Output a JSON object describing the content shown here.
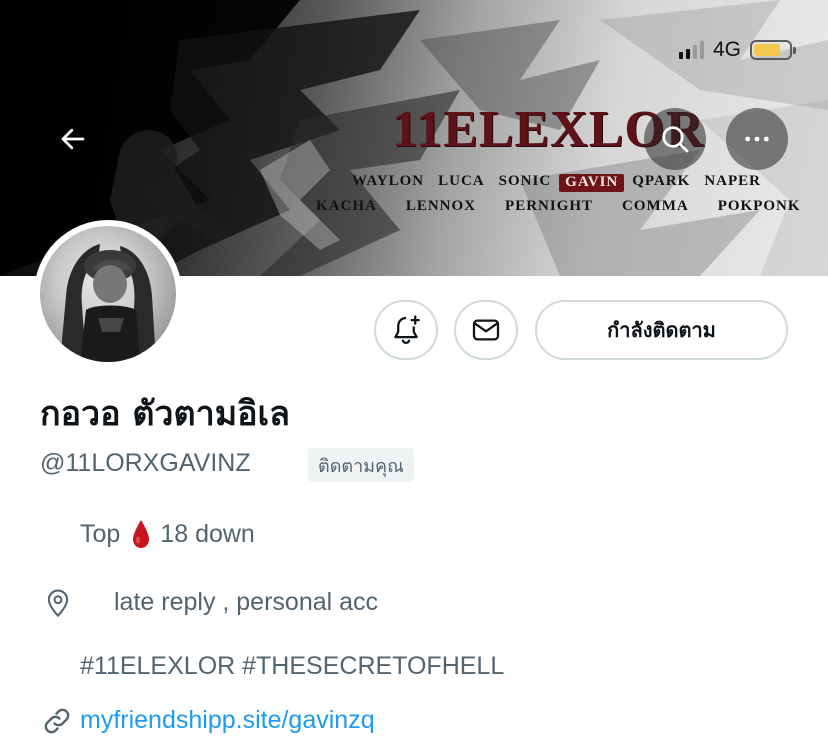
{
  "status_bar": {
    "network": "4G",
    "signal_bars_active": 2,
    "signal_bars_total": 4,
    "battery_level": 0.75,
    "battery_color": "#f2c94c"
  },
  "banner": {
    "title": "11ELEXLOR",
    "names_row1": [
      "WAYLON",
      "LUCA",
      "SONIC",
      "GAVIN",
      "QPARK",
      "NAPER"
    ],
    "names_row2": [
      "KACHA",
      "LENNOX",
      "PERNIGHT",
      "COMMA",
      "POKPONK"
    ],
    "highlighted_name": "GAVIN",
    "title_color": "#5e1318",
    "highlight_color": "#6e1419"
  },
  "header_buttons": {
    "back_icon": "arrow-left-icon",
    "search_icon": "search-icon",
    "more_icon": "more-horizontal-icon"
  },
  "profile": {
    "display_name": "กอวอ ตัวตามอิเล",
    "handle": "@11LORXGAVINZ",
    "follows_you_label": "ติดตามคุณ",
    "following_button_label": "กำลังติดตาม",
    "notify_icon": "bell-plus-icon",
    "message_icon": "mail-icon"
  },
  "bio": {
    "line1_before": "Top",
    "line1_after": "18 down",
    "line1_emoji": "drop-of-blood",
    "line2": "late reply , personal acc",
    "line3": "#11ELEXLOR #THESECRETOFHELL",
    "location_icon": "map-pin-icon",
    "link_icon": "link-icon",
    "link": "myfriendshipp.site/gavinzq"
  },
  "colors": {
    "link": "#1d9bf0",
    "secondary_text": "#536471",
    "border": "#cfd9de"
  }
}
